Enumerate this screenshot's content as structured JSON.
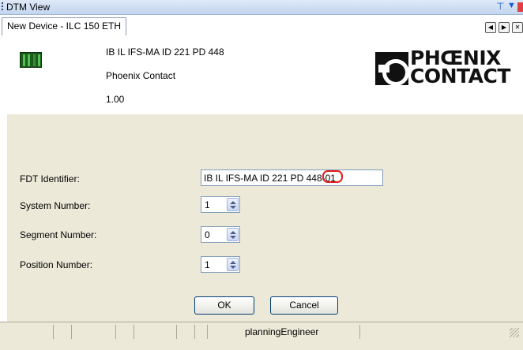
{
  "window": {
    "title": "DTM View",
    "tab_label": "New Device - ILC 150 ETH"
  },
  "device": {
    "name": "IB IL IFS-MA ID 221 PD 448",
    "vendor": "Phoenix Contact",
    "version": "1.00",
    "logo_text": [
      "PHŒNIX",
      "CONTACT"
    ]
  },
  "form": {
    "fdt_label": "FDT Identifier:",
    "fdt_value_prefix": "IB IL IFS-MA ID 221 PD 448-",
    "fdt_value_suffix": "01",
    "system_label": "System Number:",
    "system_value": "1",
    "segment_label": "Segment Number:",
    "segment_value": "0",
    "position_label": "Position Number:",
    "position_value": "1"
  },
  "buttons": {
    "ok": "OK",
    "cancel": "Cancel"
  },
  "status": {
    "user": "planningEngineer"
  },
  "colors": {
    "panel": "#ece9d8",
    "highlight": "#e02020",
    "accent": "#1d5bd6"
  }
}
